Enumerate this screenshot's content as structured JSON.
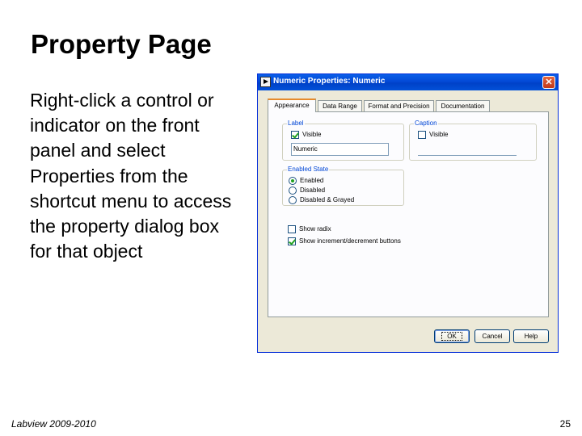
{
  "slide": {
    "title": "Property Page",
    "body": "Right-click a control or indicator on the front panel and select Properties from the shortcut menu to access the property dialog box for that object",
    "footer_left": "Labview 2009-2010",
    "page_number": "25"
  },
  "dialog": {
    "title": "Numeric Properties: Numeric",
    "close_glyph": "✕",
    "tabs": [
      {
        "label": "Appearance",
        "active": true
      },
      {
        "label": "Data Range",
        "active": false
      },
      {
        "label": "Format and Precision",
        "active": false
      },
      {
        "label": "Documentation",
        "active": false
      }
    ],
    "label_group": {
      "title": "Label",
      "visible_label": "Visible",
      "visible_checked": true,
      "value": "Numeric"
    },
    "caption_group": {
      "title": "Caption",
      "visible_label": "Visible",
      "visible_checked": false
    },
    "enabled_state": {
      "title": "Enabled State",
      "options": [
        "Enabled",
        "Disabled",
        "Disabled & Grayed"
      ],
      "selected": "Enabled"
    },
    "show_radix": {
      "label": "Show radix",
      "checked": false
    },
    "show_inc_dec": {
      "label": "Show increment/decrement buttons",
      "checked": true
    },
    "buttons": {
      "ok": "OK",
      "cancel": "Cancel",
      "help": "Help"
    }
  }
}
